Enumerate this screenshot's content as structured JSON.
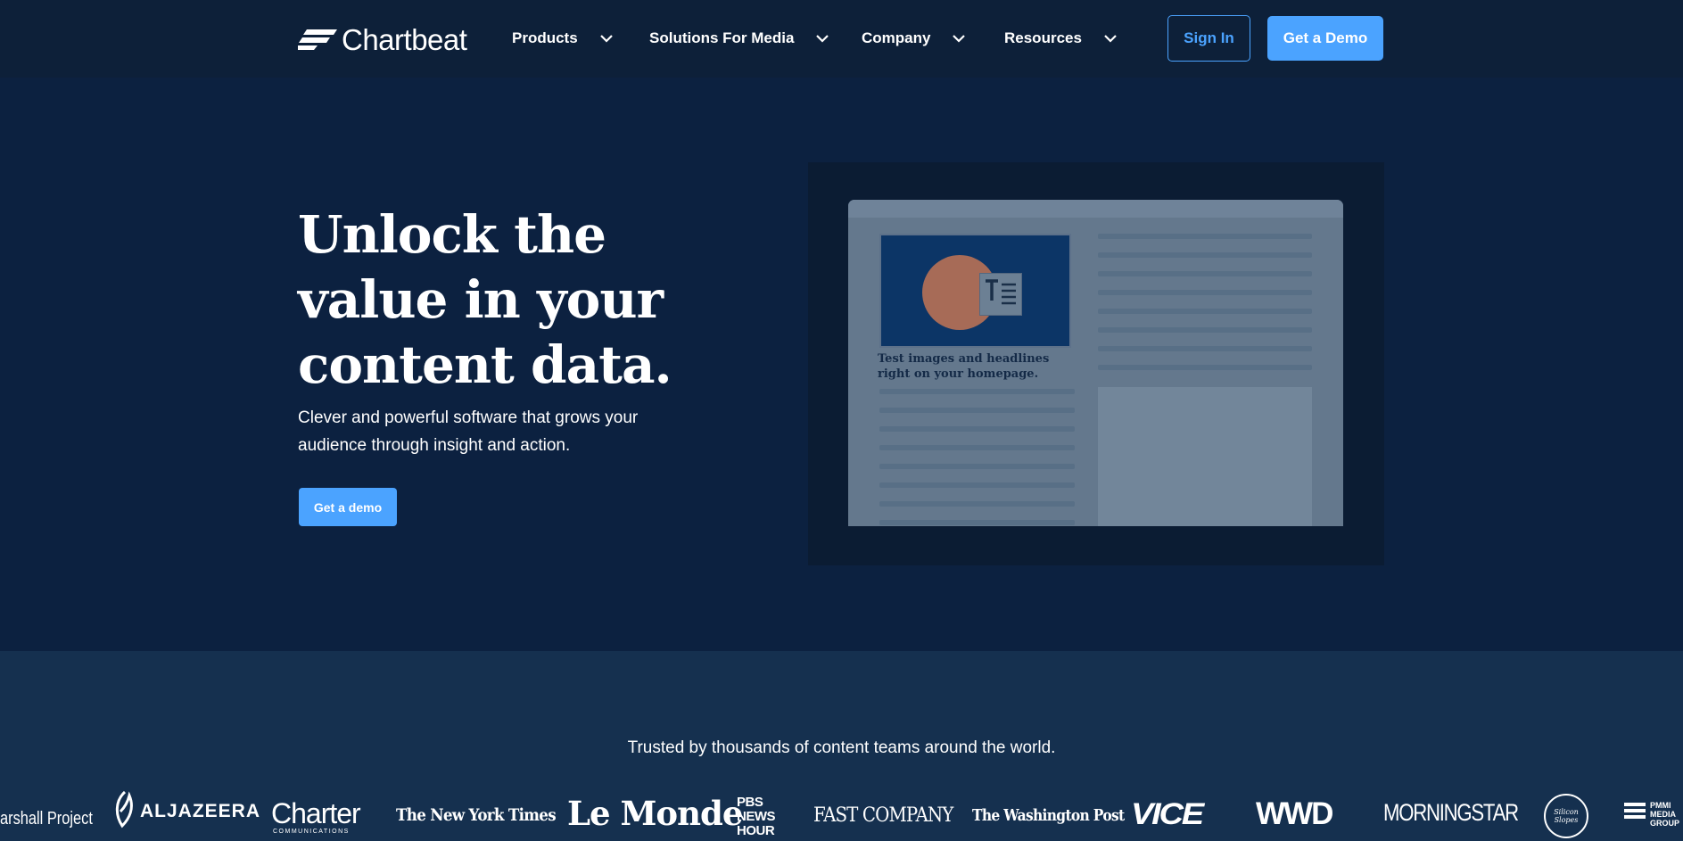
{
  "nav": {
    "logo_text": "Chartbeat",
    "menus": [
      {
        "label": "Products"
      },
      {
        "label": "Solutions For Media"
      },
      {
        "label": "Company"
      },
      {
        "label": "Resources"
      }
    ],
    "sign_in_label": "Sign In",
    "demo_label": "Get a Demo"
  },
  "hero": {
    "title": "Unlock the value in your content data.",
    "subtitle": "Clever and powerful software that grows your audience through insight and action.",
    "cta_label": "Get a demo",
    "illustration_caption": "Test images and headlines right on your homepage."
  },
  "trusted": {
    "title": "Trusted by thousands of content teams around the world.",
    "brands": [
      "arshall Project",
      "ALJAZEERA",
      "Charter",
      "COMMUNICATIONS",
      "The New York Times",
      "Le Monde",
      "PBS NEWS HOUR",
      "FAST COMPANY",
      "The Washington Post",
      "VICE",
      "WWD",
      "MORNINGSTAR",
      "Silicon Slopes",
      "PMMI MEDIA GROUP"
    ]
  },
  "colors": {
    "accent": "#4ba3ff",
    "nav_bg": "#0d2039",
    "hero_bg": "#0c2140",
    "trusted_bg": "#15304f"
  }
}
